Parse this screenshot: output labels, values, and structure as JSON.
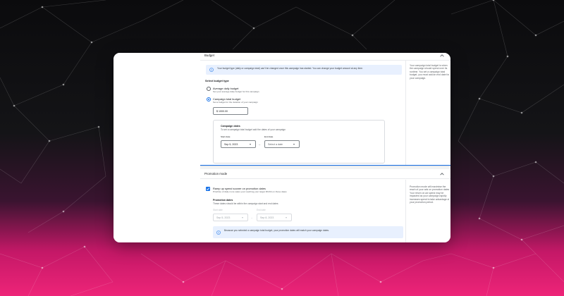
{
  "budget": {
    "title": "Budget",
    "info_text": "Your budget type (daily or campaign total) can't be changed once this campaign has started. You can change your budget amount at any time.",
    "select_label": "Select budget type",
    "options": [
      {
        "label": "Average daily budget",
        "desc": "Set your average daily budget for this campaign",
        "selected": false
      },
      {
        "label": "Campaign total budget",
        "desc": "Set a budget for the duration of your campaign",
        "selected": true
      }
    ],
    "amount_value": "$ 1000.00",
    "campaign_dates": {
      "title": "Campaign dates",
      "desc": "To set a campaign total budget add the dates of your campaign",
      "start_label": "Start date",
      "start_value": "Sep 5, 2023",
      "end_label": "End date",
      "end_placeholder": "Select a date",
      "separator": "–"
    },
    "help_text": "Your campaign total budget is when the campaign should spend over its runtime. You set a campaign total budget, you must add an end date for your campaign."
  },
  "promotion": {
    "title": "Promotion mode",
    "checkbox_label": "Ramp up spend sooner on promotion dates",
    "checkbox_desc": "Prioritise of daily more sales your reaching your target ROAS on those dates",
    "checked": true,
    "dates_title": "Promotion dates",
    "dates_desc": "These dates should be within the campaign start and end dates",
    "start_label": "Start date",
    "start_value": "Sep 5, 2023",
    "end_label": "End date",
    "end_value": "Sep 8, 2023",
    "separator": "–",
    "info_text": "Because you selected a campaign total budget, your promotion dates will match your campaign dates.",
    "help_text": "Promotion mode will maximise the reach of your ads on promotion dates. Your return on ad spend may be impacted as your campaign rapidly increases spend to take advantage of your promotion period."
  },
  "colors": {
    "accent": "#1a73e8",
    "info_bg": "#e8f0fe",
    "bg_pink": "#ee2478"
  },
  "icons": {
    "collapse": "chevron-up-icon",
    "info": "info-icon",
    "dropdown": "caret-down-icon",
    "check": "check-icon"
  }
}
